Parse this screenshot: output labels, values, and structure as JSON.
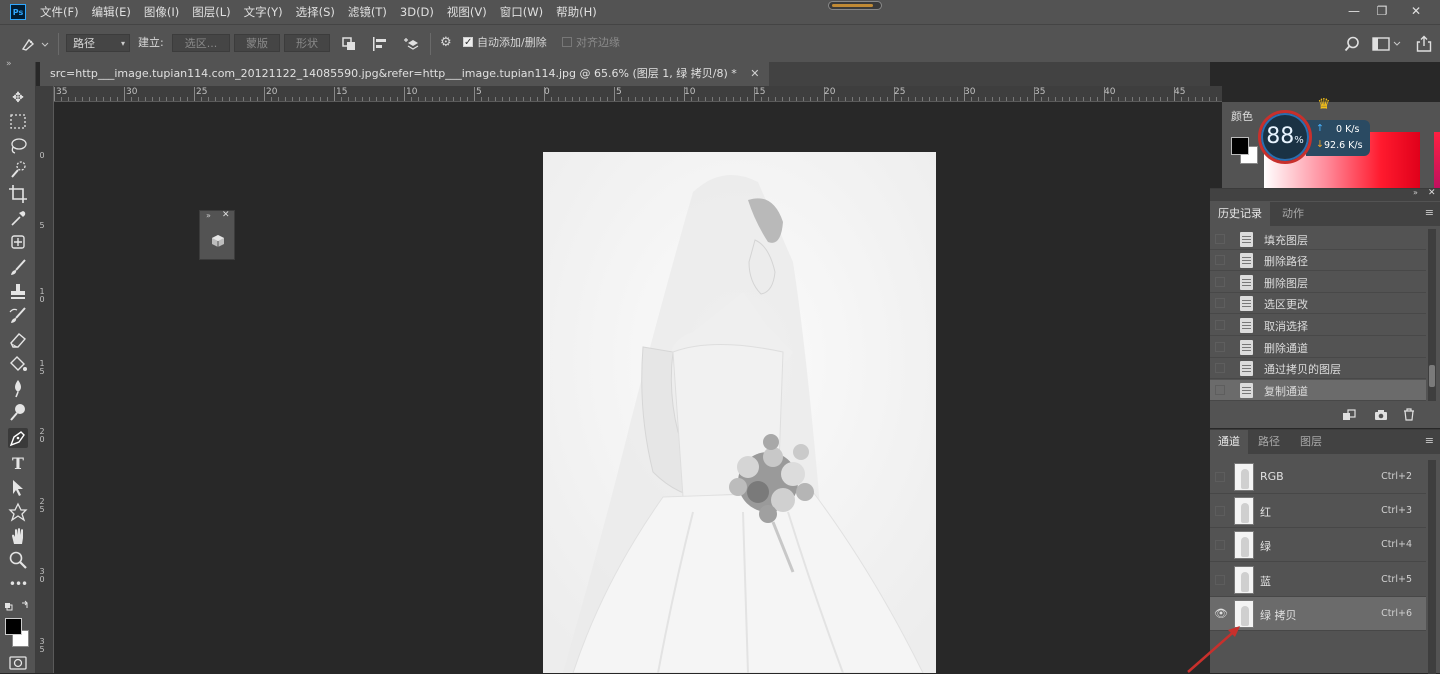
{
  "app": {
    "logo_text": "Ps"
  },
  "menu": [
    "文件(F)",
    "编辑(E)",
    "图像(I)",
    "图层(L)",
    "文字(Y)",
    "选择(S)",
    "滤镜(T)",
    "3D(D)",
    "视图(V)",
    "窗口(W)",
    "帮助(H)"
  ],
  "window_controls": {
    "minimize": "—",
    "restore": "❐",
    "close": "✕"
  },
  "options_bar": {
    "mode_value": "路径",
    "build_label": "建立:",
    "selection_btn": "选区...",
    "mask_btn": "蒙版",
    "shape_btn": "形状",
    "auto_add_delete_label": "自动添加/删除",
    "auto_add_delete_checked": true,
    "align_edges_label": "对齐边缘",
    "align_edges_checked": false
  },
  "document_tab": {
    "title": "src=http___image.tupian114.com_20121122_14085590.jpg&refer=http___image.tupian114.jpg  @  65.6%  (图层 1, 绿 拷贝/8) *",
    "close": "✕"
  },
  "ruler_top_labels": [
    "35",
    "30",
    "25",
    "20",
    "15",
    "10",
    "5",
    "0",
    "5",
    "10",
    "15",
    "20",
    "25",
    "30",
    "35",
    "40",
    "45"
  ],
  "ruler_left_labels": [
    "0",
    "5",
    "1 0",
    "1 5",
    "2 0",
    "2 5",
    "3 0",
    "3 5"
  ],
  "color_panel": {
    "tab_label": "颜色",
    "foreground": "#000000",
    "background": "#ffffff"
  },
  "speed_widget": {
    "percent": "88",
    "percent_sign": "%",
    "upload": "0 K/s",
    "download": "92.6 K/s",
    "up_arrow": "↑",
    "down_arrow": "↓",
    "badge": "VIP"
  },
  "history_panel": {
    "tabs": [
      "历史记录",
      "动作"
    ],
    "items": [
      "填充图层",
      "删除路径",
      "删除图层",
      "选区更改",
      "取消选择",
      "删除通道",
      "通过拷贝的图层",
      "复制通道"
    ],
    "selected_index": 7
  },
  "channels_panel": {
    "tabs": [
      "通道",
      "路径",
      "图层"
    ],
    "channels": [
      {
        "name": "RGB",
        "shortcut": "Ctrl+2",
        "visible": false
      },
      {
        "name": "红",
        "shortcut": "Ctrl+3",
        "visible": false
      },
      {
        "name": "绿",
        "shortcut": "Ctrl+4",
        "visible": false
      },
      {
        "name": "蓝",
        "shortcut": "Ctrl+5",
        "visible": false
      },
      {
        "name": "绿 拷贝",
        "shortcut": "Ctrl+6",
        "visible": true
      }
    ],
    "selected_index": 4
  },
  "title_progress": 0.85,
  "colors": {
    "accent": "#31a8ff",
    "panel_bg": "#535353",
    "workspace_bg": "#282828",
    "annotation_arrow": "#c8302c"
  }
}
